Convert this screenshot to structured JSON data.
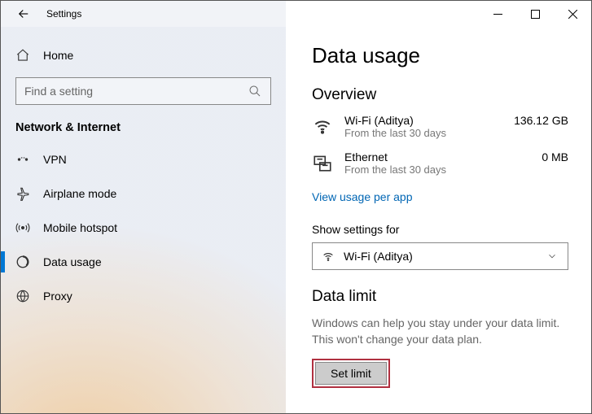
{
  "titlebar": {
    "title": "Settings"
  },
  "sidebar": {
    "home_label": "Home",
    "search_placeholder": "Find a setting",
    "section_title": "Network & Internet",
    "items": [
      {
        "label": "VPN"
      },
      {
        "label": "Airplane mode"
      },
      {
        "label": "Mobile hotspot"
      },
      {
        "label": "Data usage"
      },
      {
        "label": "Proxy"
      }
    ]
  },
  "main": {
    "page_title": "Data usage",
    "overview_heading": "Overview",
    "networks": [
      {
        "name": "Wi-Fi (Aditya)",
        "sub": "From the last 30 days",
        "value": "136.12 GB"
      },
      {
        "name": "Ethernet",
        "sub": "From the last 30 days",
        "value": "0 MB"
      }
    ],
    "view_link": "View usage per app",
    "show_settings_label": "Show settings for",
    "dropdown_value": "Wi-Fi (Aditya)",
    "data_limit_heading": "Data limit",
    "data_limit_desc": "Windows can help you stay under your data limit. This won't change your data plan.",
    "set_limit_button": "Set limit"
  }
}
